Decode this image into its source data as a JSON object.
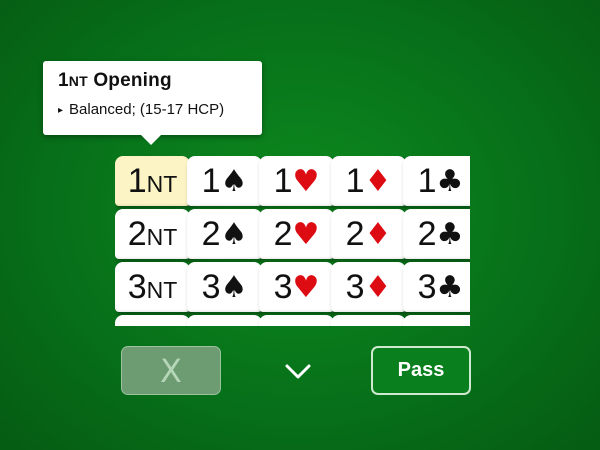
{
  "tooltip": {
    "level": "1",
    "strain": "NT",
    "title_rest": " Opening",
    "bullet": "▸",
    "description": "Balanced; (15-17 HCP)"
  },
  "grid": {
    "rows": [
      [
        {
          "level": "1",
          "strain": "NT",
          "suit_symbol": "",
          "color": "black",
          "selected": true
        },
        {
          "level": "1",
          "strain": "",
          "suit_symbol": "♠",
          "color": "black"
        },
        {
          "level": "1",
          "strain": "",
          "suit_symbol": "♥",
          "color": "red"
        },
        {
          "level": "1",
          "strain": "",
          "suit_symbol": "♦",
          "color": "red"
        },
        {
          "level": "1",
          "strain": "",
          "suit_symbol": "♣",
          "color": "black"
        }
      ],
      [
        {
          "level": "2",
          "strain": "NT",
          "suit_symbol": "",
          "color": "black"
        },
        {
          "level": "2",
          "strain": "",
          "suit_symbol": "♠",
          "color": "black"
        },
        {
          "level": "2",
          "strain": "",
          "suit_symbol": "♥",
          "color": "red"
        },
        {
          "level": "2",
          "strain": "",
          "suit_symbol": "♦",
          "color": "red"
        },
        {
          "level": "2",
          "strain": "",
          "suit_symbol": "♣",
          "color": "black"
        }
      ],
      [
        {
          "level": "3",
          "strain": "NT",
          "suit_symbol": "",
          "color": "black"
        },
        {
          "level": "3",
          "strain": "",
          "suit_symbol": "♠",
          "color": "black"
        },
        {
          "level": "3",
          "strain": "",
          "suit_symbol": "♥",
          "color": "red"
        },
        {
          "level": "3",
          "strain": "",
          "suit_symbol": "♦",
          "color": "red"
        },
        {
          "level": "3",
          "strain": "",
          "suit_symbol": "♣",
          "color": "black"
        }
      ],
      [
        {
          "level": "",
          "strain": "",
          "suit_symbol": "",
          "color": "black"
        },
        {
          "level": "",
          "strain": "",
          "suit_symbol": "",
          "color": "black"
        },
        {
          "level": "",
          "strain": "",
          "suit_symbol": "",
          "color": "black"
        },
        {
          "level": "",
          "strain": "",
          "suit_symbol": "",
          "color": "black"
        },
        {
          "level": "",
          "strain": "",
          "suit_symbol": "",
          "color": "black"
        }
      ]
    ]
  },
  "controls": {
    "double_label": "X",
    "double_enabled": false,
    "expand_icon": "chevron-down-icon",
    "pass_label": "Pass"
  },
  "colors": {
    "table_green": "#07711a",
    "suit_red": "#dd0b12",
    "selected_bid": "#fdf4c6"
  }
}
